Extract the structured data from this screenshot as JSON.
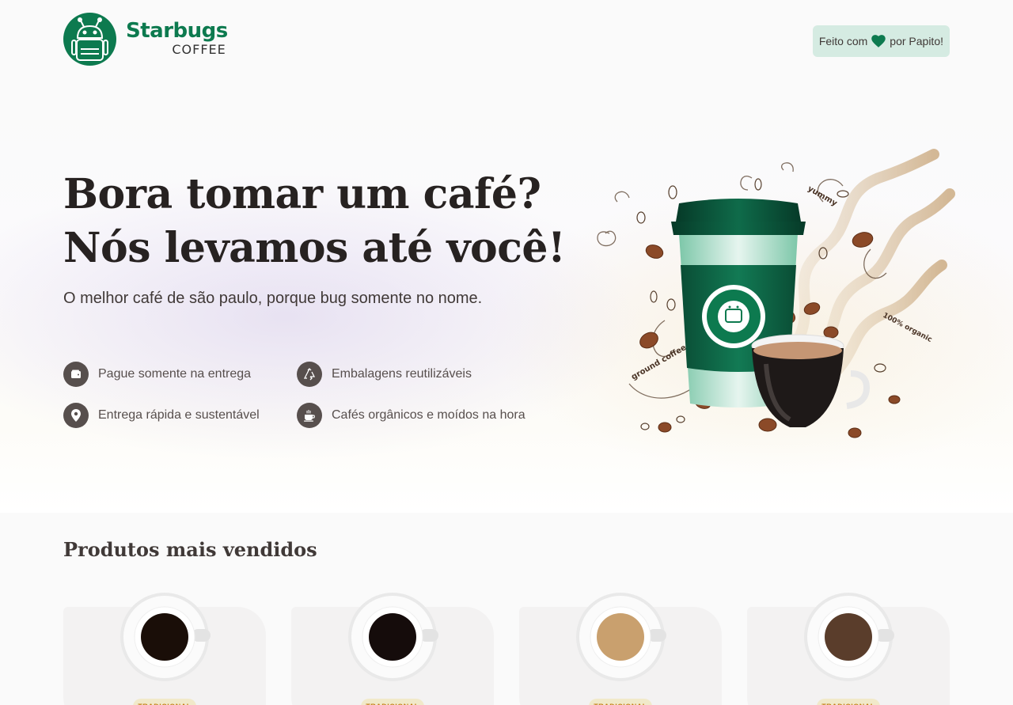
{
  "brand": {
    "name": "Starbugs",
    "sub": "COFFEE"
  },
  "made_by": {
    "prefix": "Feito com",
    "suffix": "por Papito!",
    "icon": "heart-icon"
  },
  "hero": {
    "title_line1": "Bora tomar um café?",
    "title_line2": "Nós levamos até você!",
    "subtitle": "O melhor café de são paulo, porque bug somente no nome.",
    "features": [
      {
        "label": "Pague somente na entrega",
        "icon": "wallet-icon"
      },
      {
        "label": "Embalagens reutilizáveis",
        "icon": "recycle-icon"
      },
      {
        "label": "Entrega rápida e sustentável",
        "icon": "map-pin-icon"
      },
      {
        "label": "Cafés orgânicos e moídos na hora",
        "icon": "coffee-icon"
      }
    ],
    "illustration_texts": {
      "yummy": "yummy",
      "organic": "100% organic",
      "ground": "ground coffee"
    }
  },
  "products": {
    "title": "Produtos mais vendidos",
    "items": [
      {
        "tag": "TRADICIONAL",
        "coffee_color": "#1a0e08"
      },
      {
        "tag": "TRADICIONAL",
        "coffee_color": "#150c0b"
      },
      {
        "tag": "TRADICIONAL",
        "coffee_color": "#c9a06e"
      },
      {
        "tag": "TRADICIONAL",
        "coffee_color": "#5a3d2b"
      }
    ]
  },
  "colors": {
    "brand_green": "#0d7a4f",
    "badge_bg": "#d5ebe2",
    "text_dark": "#272221",
    "feature_icon_bg": "#574f4d"
  }
}
